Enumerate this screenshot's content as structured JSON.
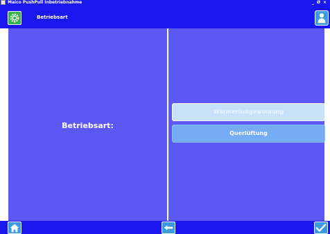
{
  "window": {
    "title": "Maico PushPull Inbetriebnahme",
    "controls": {
      "minimize": "_",
      "maximize": "Ø",
      "close": "×"
    }
  },
  "header": {
    "title": "Betriebsart",
    "left_icon": "settings-gear-icon",
    "right_icon": "user-icon"
  },
  "main": {
    "label": "Betriebsart:",
    "options": [
      {
        "label": "Wärmerückgewinnung",
        "state": "selected"
      },
      {
        "label": "Querlüftung",
        "state": "normal"
      }
    ]
  },
  "footer": {
    "left_icon": "home-icon",
    "center_icon": "back-arrow-icon",
    "right_icon": "checkmark-icon"
  },
  "colors": {
    "bar": "#1a16ee",
    "panel": "#5b58f5",
    "selected_option": "#c8e1fb",
    "option": "#76acf3",
    "button": "#3a9be0"
  }
}
